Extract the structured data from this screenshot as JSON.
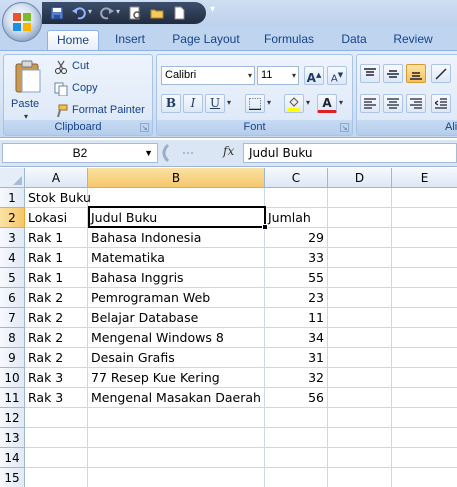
{
  "tabs": [
    {
      "label": "Home",
      "active": true
    },
    {
      "label": "Insert",
      "active": false
    },
    {
      "label": "Page Layout",
      "active": false
    },
    {
      "label": "Formulas",
      "active": false
    },
    {
      "label": "Data",
      "active": false
    },
    {
      "label": "Review",
      "active": false
    }
  ],
  "clipboard": {
    "paste_label": "Paste",
    "cut_label": "Cut",
    "copy_label": "Copy",
    "format_painter_label": "Format Painter",
    "group_label": "Clipboard"
  },
  "font": {
    "family": "Calibri",
    "size": "11",
    "grow_label": "A",
    "shrink_label": "A",
    "bold_label": "B",
    "italic_label": "I",
    "underline_label": "U",
    "font_color_label": "A",
    "group_label": "Font"
  },
  "alignment": {
    "group_label_partial": "Ali"
  },
  "formula_bar": {
    "name_box": "B2",
    "fx_label": "fx",
    "content": "Judul Buku"
  },
  "columns": [
    "A",
    "B",
    "C",
    "D",
    "E"
  ],
  "selected_column": "B",
  "selected_row": "2",
  "rows": [
    {
      "num": "1",
      "a": "Stok Buku",
      "b": "",
      "c": ""
    },
    {
      "num": "2",
      "a": "Lokasi",
      "b": "Judul Buku",
      "c": "Jumlah"
    },
    {
      "num": "3",
      "a": "Rak 1",
      "b": "Bahasa Indonesia",
      "c": "29"
    },
    {
      "num": "4",
      "a": "Rak 1",
      "b": "Matematika",
      "c": "33"
    },
    {
      "num": "5",
      "a": "Rak 1",
      "b": "Bahasa Inggris",
      "c": "55"
    },
    {
      "num": "6",
      "a": "Rak 2",
      "b": "Pemrograman Web",
      "c": "23"
    },
    {
      "num": "7",
      "a": "Rak 2",
      "b": "Belajar Database",
      "c": "11"
    },
    {
      "num": "8",
      "a": "Rak 2",
      "b": "Mengenal Windows 8",
      "c": "34"
    },
    {
      "num": "9",
      "a": "Rak 2",
      "b": "Desain Grafis",
      "c": "31"
    },
    {
      "num": "10",
      "a": "Rak 3",
      "b": "77 Resep Kue Kering",
      "c": "32"
    },
    {
      "num": "11",
      "a": "Rak 3",
      "b": "Mengenal Masakan Daerah",
      "c": "56"
    },
    {
      "num": "12",
      "a": "",
      "b": "",
      "c": ""
    },
    {
      "num": "13",
      "a": "",
      "b": "",
      "c": ""
    },
    {
      "num": "14",
      "a": "",
      "b": "",
      "c": ""
    },
    {
      "num": "15",
      "a": "",
      "b": "",
      "c": ""
    }
  ],
  "colors": {
    "tab_bar": "#bfd5ef",
    "selected_header": "#f6c66a",
    "gridline": "#d0d7e5"
  }
}
